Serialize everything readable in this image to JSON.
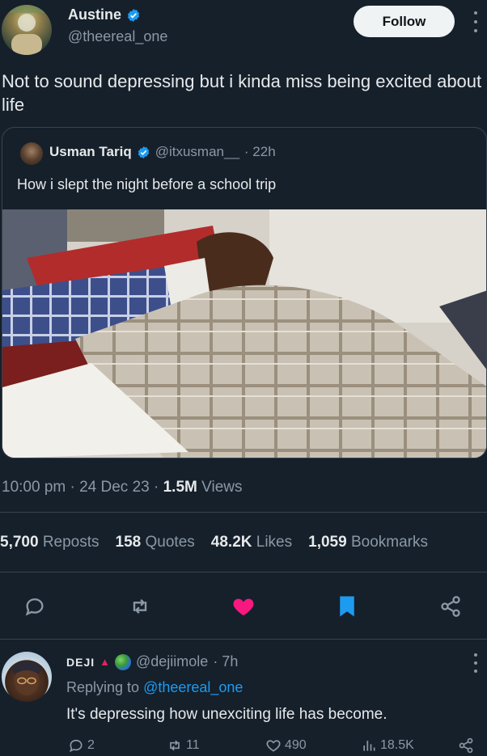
{
  "tweet": {
    "author_name": "Austine",
    "author_handle": "@theereal_one",
    "follow_label": "Follow",
    "text": "Not to sound depressing but i kinda miss being excited about life",
    "timestamp": "10:00 pm · 24 Dec 23 ·",
    "views_count": "1.5M",
    "views_label": "Views"
  },
  "quoted": {
    "author_name": "Usman Tariq",
    "author_handle": "@itxusman__",
    "time": "· 22h",
    "text": "How i slept the night before a school trip"
  },
  "stats": [
    {
      "count": "5,700",
      "label": "Reposts"
    },
    {
      "count": "158",
      "label": "Quotes"
    },
    {
      "count": "48.2K",
      "label": "Likes"
    },
    {
      "count": "1,059",
      "label": "Bookmarks"
    }
  ],
  "actions": {
    "reply_icon": "reply-icon",
    "repost_icon": "repost-icon",
    "like_icon": "heart-filled-icon",
    "bookmark_icon": "bookmark-filled-icon",
    "share_icon": "share-icon"
  },
  "reply": {
    "author_name": "DEJI",
    "author_handle": "@dejiimole",
    "time": "· 7h",
    "replying_prefix": "Replying to",
    "replying_handle": "@theereal_one",
    "text": "It's depressing how unexciting life has become.",
    "replies": "2",
    "reposts": "11",
    "likes": "490",
    "views": "18.5K"
  },
  "colors": {
    "background": "#15202b",
    "accent": "#1d9bf0",
    "like": "#f91880",
    "muted": "#8b98a5"
  }
}
